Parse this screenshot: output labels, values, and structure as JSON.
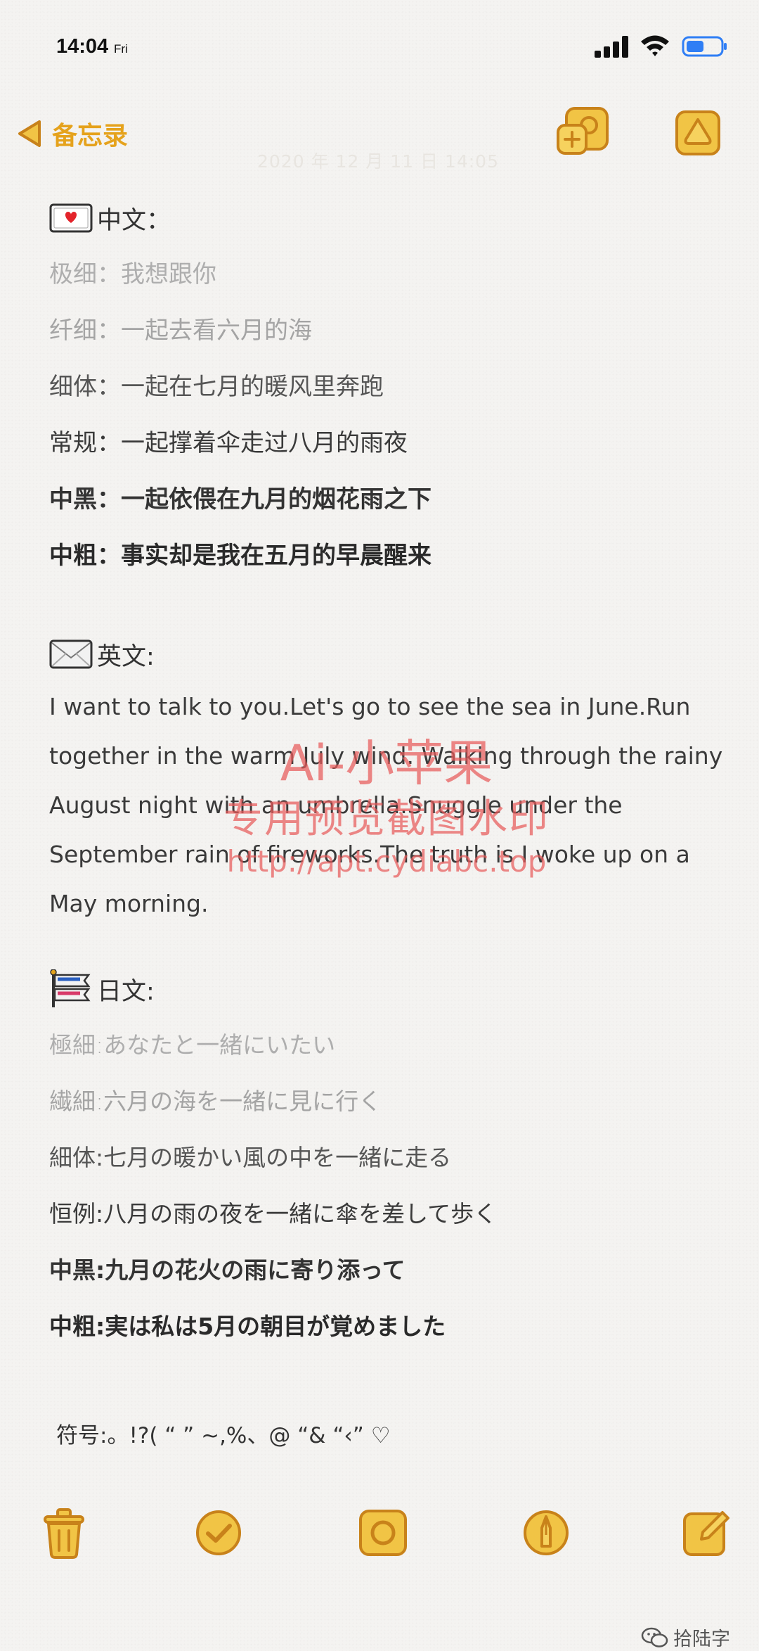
{
  "status_bar": {
    "time": "14:04",
    "day": "Fri",
    "icons": [
      "signal-icon",
      "wifi-icon",
      "battery-icon"
    ]
  },
  "nav": {
    "back_label": "备忘录",
    "date": "2020 年 12 月 11 日 14:05",
    "icons": [
      "chevron-left-icon",
      "share-add-person-icon",
      "more-icon"
    ]
  },
  "sections": {
    "chinese": {
      "heading": "中文：",
      "icon": "love-letter-icon",
      "lines": [
        "极细：我想跟你",
        "纤细：一起去看六月的海",
        "细体：一起在七月的暖风里奔跑",
        "常规：一起撑着伞走过八月的雨夜",
        "中黑：一起依偎在九月的烟花雨之下",
        "中粗：事实却是我在五月的早晨醒来"
      ]
    },
    "english": {
      "heading": "英文:",
      "icon": "envelope-icon",
      "paragraph": "I want to talk to you.Let's go to see the sea in June.Run together in the warm July wind. Walking through the rainy August night with an umbrella.Snuggle under the September rain of fireworks.The truth is I woke up on a May morning."
    },
    "japanese": {
      "heading": "日文:",
      "icon": "carp-streamer-icon",
      "lines": [
        "極細:あなたと一緒にいたい",
        "繊細:六月の海を一緒に見に行く",
        "細体:七月の暖かい風の中を一緒に走る",
        "恒例:八月の雨の夜を一緒に傘を差して歩く",
        "中黒:九月の花火の雨に寄り添って",
        "中粗:実は私は5月の朝目が覚めました"
      ]
    },
    "symbols": "符号:。!?( “ ” ~,%、@ “& “‹” ♡"
  },
  "watermark": {
    "line1": "Ai-小苹果",
    "line2": "专用预览截图水印",
    "line3": "http://apt.cydiabc.top"
  },
  "toolbar": {
    "icons": [
      "trash-icon",
      "checklist-icon",
      "camera-icon",
      "pen-markup-icon",
      "compose-icon"
    ]
  },
  "footer": {
    "wechat_label": "拾陆字",
    "icon": "wechat-icon"
  },
  "colors": {
    "accent": "#e5a21c",
    "background": "#f4f3f1",
    "watermark": "#e85a5a"
  }
}
